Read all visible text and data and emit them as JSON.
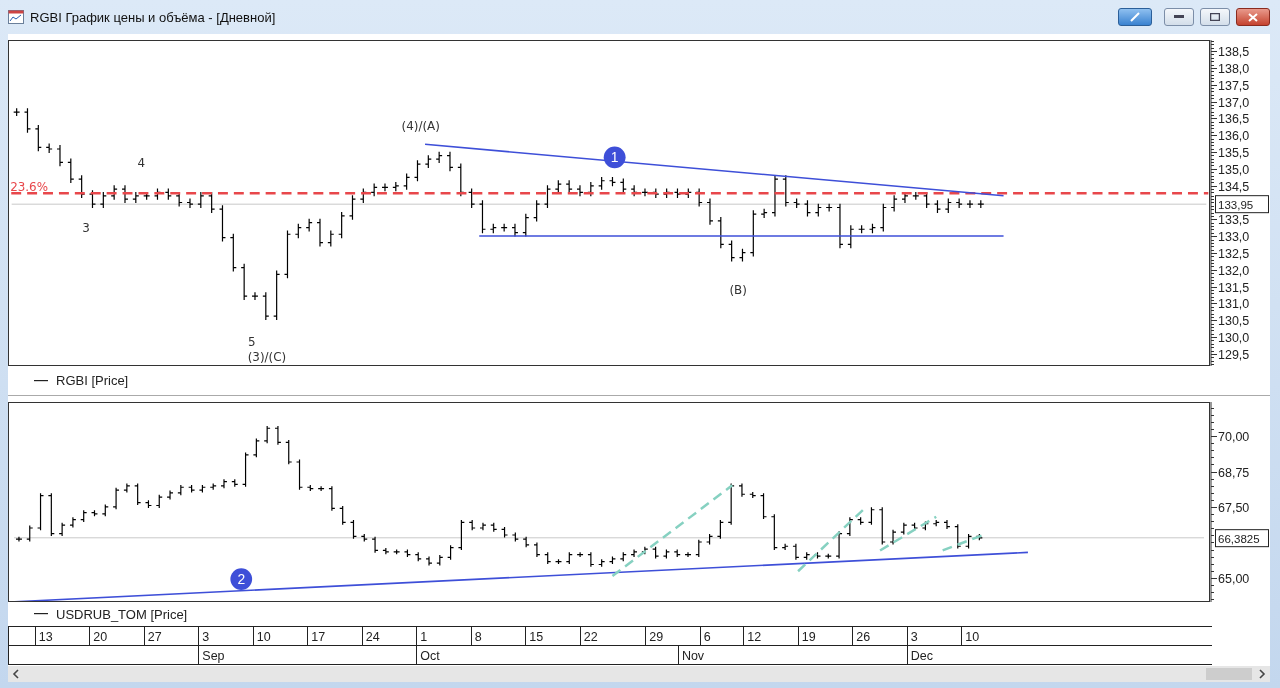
{
  "window": {
    "title": "RGBI График цены и объёма - [Дневной]"
  },
  "panes": [
    {
      "legend": "RGBI [Price]",
      "price_tag": "133,95",
      "axis_labels": [
        "138,5",
        "138,0",
        "137,5",
        "137,0",
        "136,5",
        "136,0",
        "135,5",
        "135,0",
        "134,5",
        "133,5",
        "133,0",
        "132,5",
        "132,0",
        "131,5",
        "131,0",
        "130,5",
        "130,0",
        "129,5"
      ],
      "labels": [
        "23.6%",
        "(4)/(A)",
        "4",
        "3",
        "5",
        "(3)/(C)",
        "(B)"
      ],
      "badges": [
        "1"
      ]
    },
    {
      "legend": "USDRUB_TOM [Price]",
      "price_tag": "66,3825",
      "axis_labels": [
        "70,00",
        "68,75",
        "67,50",
        "65,00"
      ],
      "badges": [
        "2"
      ]
    }
  ],
  "date_axis": {
    "days": [
      "13",
      "20",
      "27",
      "3",
      "10",
      "17",
      "24",
      "1",
      "8",
      "15",
      "22",
      "29",
      "6",
      "12",
      "19",
      "26",
      "3",
      "10"
    ],
    "months": [
      "Sep",
      "Oct",
      "Nov",
      "Dec"
    ]
  }
}
